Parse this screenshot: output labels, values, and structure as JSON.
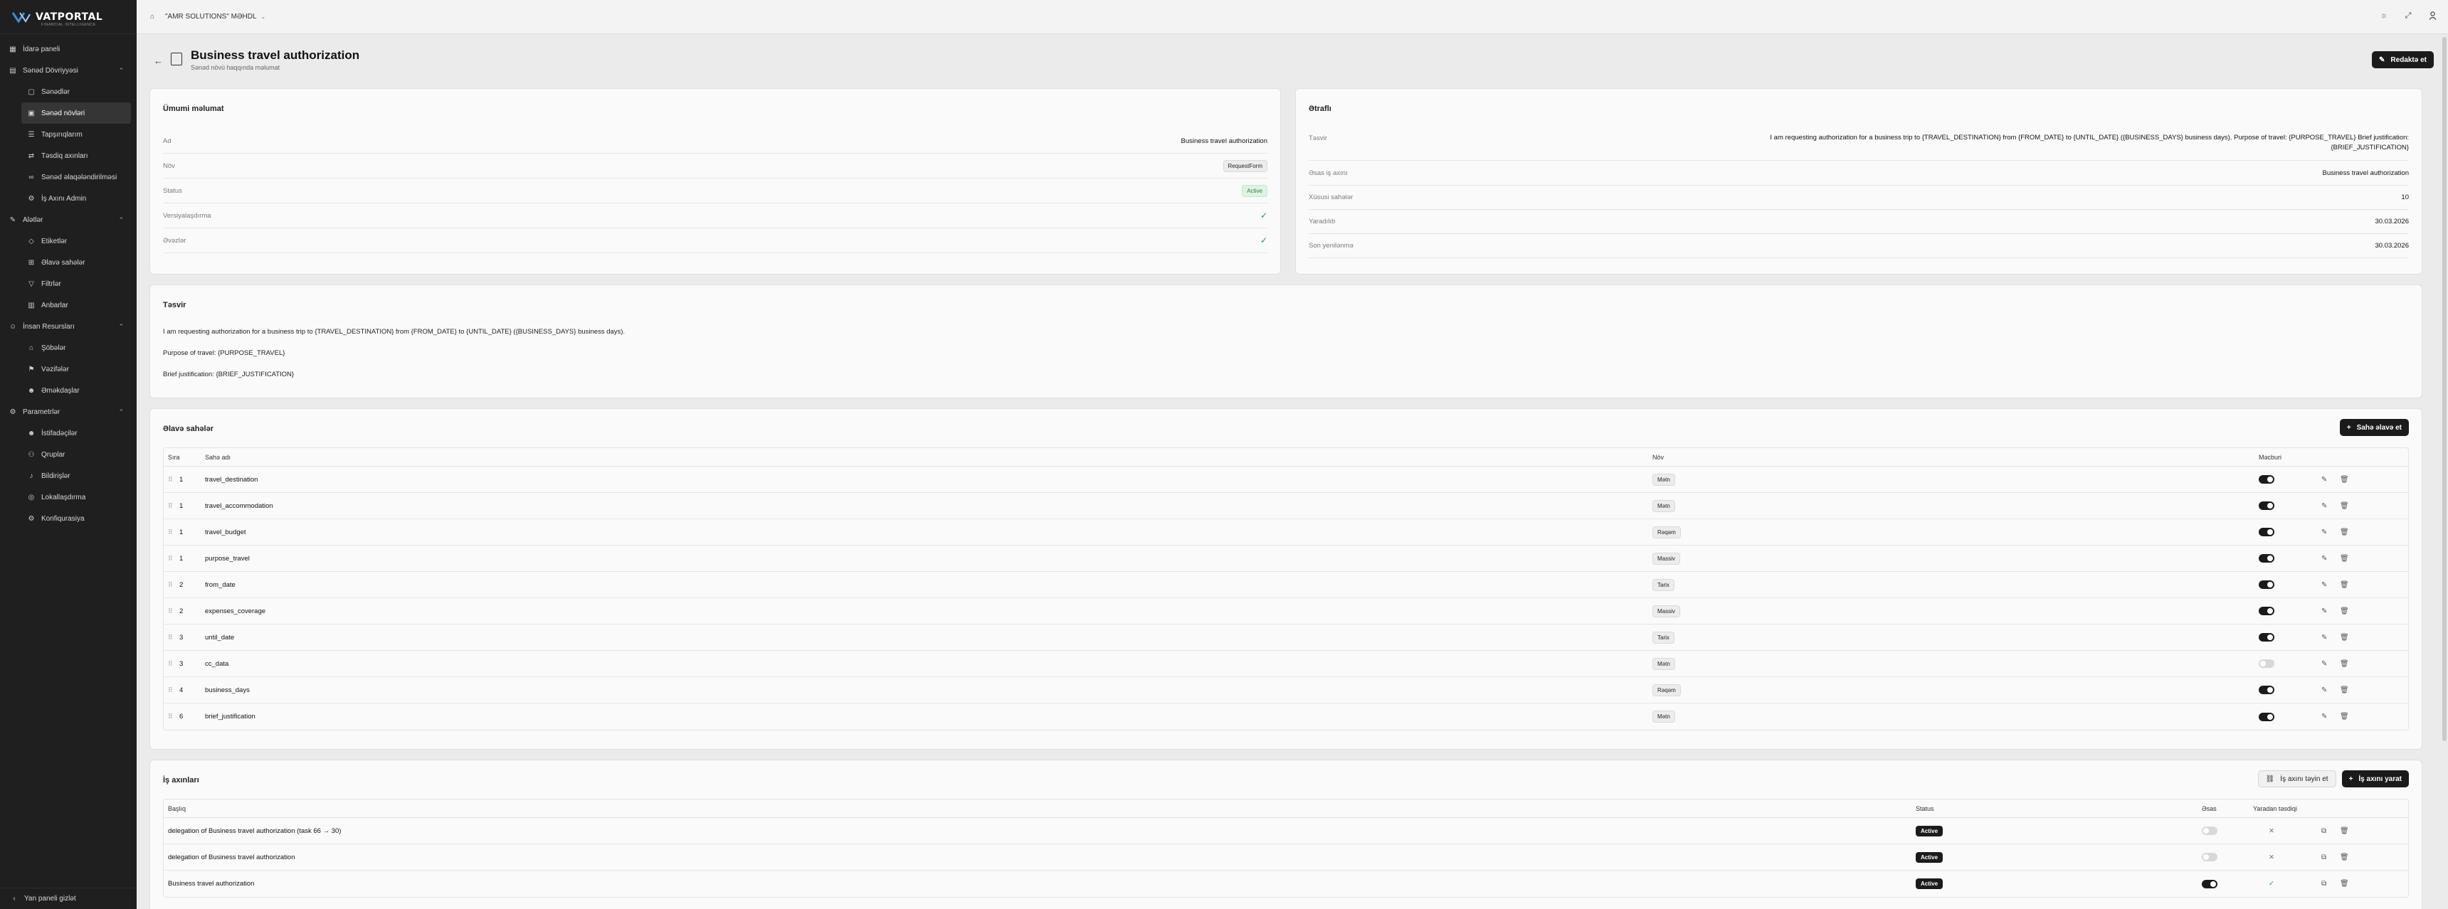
{
  "brand": {
    "name": "VATPORTAL",
    "tagline": "FINANCIAL INTELLIGENCE"
  },
  "sidebar": {
    "items": [
      {
        "label": "İdarə paneli",
        "icon": "dashboard-icon"
      },
      {
        "label": "Sənəd Dövriyyəsi",
        "icon": "folder-icon"
      },
      {
        "label": "Sənədlər",
        "icon": "file-icon"
      },
      {
        "label": "Sənəd növləri",
        "icon": "file-type-icon"
      },
      {
        "label": "Tapşırıqlarım",
        "icon": "tasks-icon"
      },
      {
        "label": "Təsdiq axınları",
        "icon": "workflow-icon"
      },
      {
        "label": "Sənəd əlaqələndirilməsi",
        "icon": "link-icon"
      },
      {
        "label": "İş Axını Admin",
        "icon": "admin-icon"
      },
      {
        "label": "Alətlər",
        "icon": "tools-icon"
      },
      {
        "label": "Etiketlər",
        "icon": "tag-icon"
      },
      {
        "label": "Əlavə sahələr",
        "icon": "fields-icon"
      },
      {
        "label": "Filtrlər",
        "icon": "filter-icon"
      },
      {
        "label": "Anbarlar",
        "icon": "storage-icon"
      },
      {
        "label": "İnsan Resursları",
        "icon": "people-icon"
      },
      {
        "label": "Şöbələr",
        "icon": "department-icon"
      },
      {
        "label": "Vəzifələr",
        "icon": "position-icon"
      },
      {
        "label": "Əməkdaşlar",
        "icon": "employees-icon"
      },
      {
        "label": "Parametrlər",
        "icon": "settings-icon"
      },
      {
        "label": "İstifadəçilər",
        "icon": "users-icon"
      },
      {
        "label": "Qruplar",
        "icon": "groups-icon"
      },
      {
        "label": "Bildirişlər",
        "icon": "bell-icon"
      },
      {
        "label": "Lokallaşdırma",
        "icon": "globe-icon"
      },
      {
        "label": "Konfiqurasiya",
        "icon": "config-icon"
      }
    ],
    "footer": "Yan paneli gizlət"
  },
  "topbar": {
    "company": "\"AMR SOLUTIONS\" MƏHDL"
  },
  "page": {
    "title": "Business travel authorization",
    "subtitle": "Sənəd növü haqqında məlumat",
    "edit_label": "Redaktə et"
  },
  "general": {
    "title": "Ümumi məlumat",
    "rows": [
      {
        "k": "Ad",
        "v": "Business travel authorization"
      },
      {
        "k": "Növ",
        "v": "RequestForm"
      },
      {
        "k": "Status",
        "v": "Active"
      },
      {
        "k": "Versiyalaşdırma",
        "v": "✓"
      },
      {
        "k": "Əvəzlər",
        "v": "✓"
      }
    ]
  },
  "details": {
    "title": "Ətraflı",
    "rows": [
      {
        "k": "Təsvir",
        "v": "I am requesting authorization for a business trip to {TRAVEL_DESTINATION} from {FROM_DATE} to {UNTIL_DATE} ({BUSINESS_DAYS} business days). Purpose of travel: {PURPOSE_TRAVEL} Brief justification: {BRIEF_JUSTIFICATION}"
      },
      {
        "k": "Əsas iş axını",
        "v": "Business travel authorization"
      },
      {
        "k": "Xüsusi sahələr",
        "v": "10"
      },
      {
        "k": "Yaradılıb",
        "v": "30.03.2026"
      },
      {
        "k": "Son yenilənmə",
        "v": "30.03.2026"
      }
    ]
  },
  "description": {
    "title": "Təsvir",
    "lines": [
      "I am requesting authorization for a business trip to {TRAVEL_DESTINATION} from {FROM_DATE} to {UNTIL_DATE} ({BUSINESS_DAYS} business days).",
      "Purpose of travel: {PURPOSE_TRAVEL}",
      "Brief justification: {BRIEF_JUSTIFICATION}"
    ]
  },
  "fields": {
    "title": "Əlavə sahələr",
    "add_label": "Sahə əlavə et",
    "headers": {
      "order": "Sıra",
      "name": "Sahə adı",
      "type": "Növ",
      "required": "Məcburi"
    },
    "rows": [
      {
        "order": "1",
        "name": "travel_destination",
        "type": "Mətn",
        "required": true
      },
      {
        "order": "1",
        "name": "travel_accommodation",
        "type": "Mətn",
        "required": true
      },
      {
        "order": "1",
        "name": "travel_budget",
        "type": "Rəqəm",
        "required": true
      },
      {
        "order": "1",
        "name": "purpose_travel",
        "type": "Massiv",
        "required": true
      },
      {
        "order": "2",
        "name": "from_date",
        "type": "Tarix",
        "required": true
      },
      {
        "order": "2",
        "name": "expenses_coverage",
        "type": "Massiv",
        "required": true
      },
      {
        "order": "3",
        "name": "until_date",
        "type": "Tarix",
        "required": true
      },
      {
        "order": "3",
        "name": "cc_data",
        "type": "Mətn",
        "required": false
      },
      {
        "order": "4",
        "name": "business_days",
        "type": "Rəqəm",
        "required": true
      },
      {
        "order": "6",
        "name": "brief_justification",
        "type": "Mətn",
        "required": true
      }
    ]
  },
  "workflows": {
    "title": "İş axınları",
    "assign_label": "İş axını təyin et",
    "create_label": "İş axını yarat",
    "headers": {
      "name": "Başlıq",
      "status": "Status",
      "main": "Əsas",
      "creator_approval": "Yaradan təsdiqi"
    },
    "rows": [
      {
        "name": "delegation of Business travel authorization (task 66 → 30)",
        "status": "Active",
        "main": false,
        "approval": "✕"
      },
      {
        "name": "delegation of Business travel authorization",
        "status": "Active",
        "main": false,
        "approval": "✕"
      },
      {
        "name": "Business travel authorization",
        "status": "Active",
        "main": true,
        "approval": "✓"
      }
    ]
  }
}
